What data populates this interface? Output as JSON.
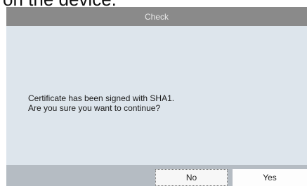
{
  "caption": "on the device.",
  "dialog": {
    "title": "Check",
    "message_line1": "Certificate has been signed with SHA1.",
    "message_line2": "Are you sure you want to continue?",
    "buttons": {
      "no_label": "No",
      "yes_label": "Yes"
    }
  }
}
